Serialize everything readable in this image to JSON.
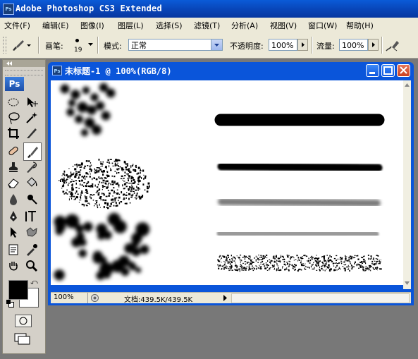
{
  "window": {
    "title": "Adobe Photoshop CS3 Extended",
    "app_icon": "Ps"
  },
  "menu": [
    {
      "label": "文件(F)"
    },
    {
      "label": "编辑(E)"
    },
    {
      "label": "图像(I)"
    },
    {
      "label": "图层(L)"
    },
    {
      "label": "选择(S)"
    },
    {
      "label": "滤镜(T)"
    },
    {
      "label": "分析(A)"
    },
    {
      "label": "视图(V)"
    },
    {
      "label": "窗口(W)"
    },
    {
      "label": "帮助(H)"
    }
  ],
  "options": {
    "brush_label": "画笔:",
    "brush_size": "19",
    "mode_label": "模式:",
    "mode_value": "正常",
    "opacity_label": "不透明度:",
    "opacity_value": "100%",
    "flow_label": "流量:",
    "flow_value": "100%"
  },
  "toolbox": {
    "logo": "Ps"
  },
  "document": {
    "title": "未标题-1 @ 100%(RGB/8)",
    "zoom": "100%",
    "doc_size": "文档:439.5K/439.5K"
  },
  "colors": {
    "titlebar": "#0843b4",
    "chrome": "#ece9d8",
    "workspace": "#787878",
    "foreground": "#000000",
    "background": "#ffffff"
  }
}
